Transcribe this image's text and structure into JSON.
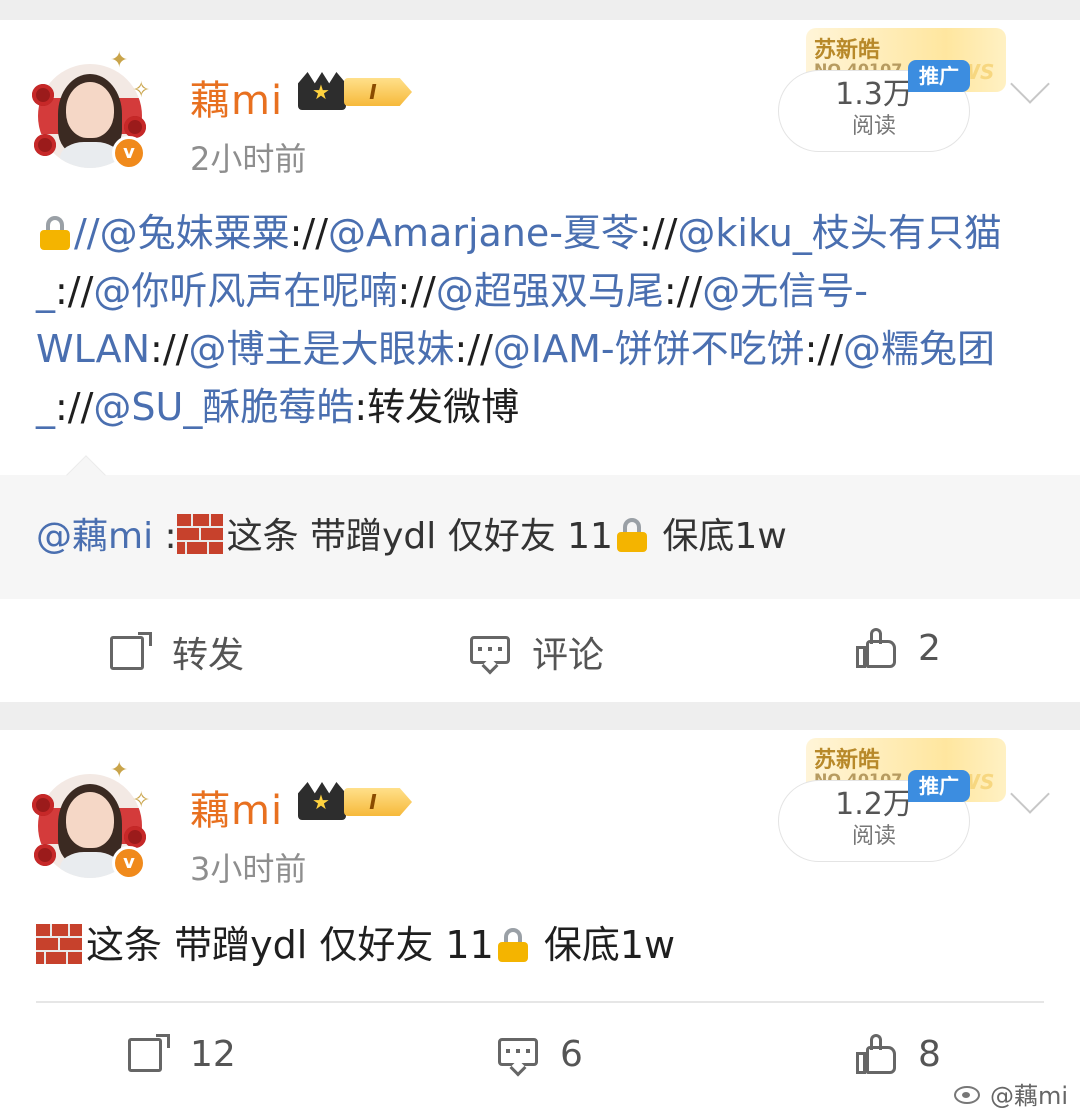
{
  "posts": [
    {
      "username": "藕mi",
      "level_label": "I",
      "time": "2小时前",
      "promo_name": "苏新皓",
      "promo_no": "NO.40107",
      "promo_ws": "WS",
      "promo_tag": "推广",
      "reads": "1.3万",
      "reads_label": "阅读",
      "body": {
        "seg1": "//@兔妹粟粟",
        "seg2": "://",
        "seg3": "@Amarjane-夏苓",
        "seg4": "://",
        "seg5": "@kiku_枝头有只猫_",
        "seg6": "://",
        "seg7": "@你听风声在呢喃",
        "seg8": "://",
        "seg9": "@超强双马尾",
        "seg10": "://",
        "seg11": "@无信号-WLAN",
        "seg12": "://",
        "seg13": "@博主是大眼妹",
        "seg14": "://",
        "seg15": "@IAM-饼饼不吃饼",
        "seg16": "://",
        "seg17": "@糯兔团_",
        "seg18": "://",
        "seg19": "@SU_酥脆莓皓",
        "seg20": ":转发微博"
      },
      "quote": {
        "mention": "@藕mi",
        "sep": " :",
        "text_a": "这条 带蹭ydl 仅好友 11",
        "text_b": " 保底1w"
      },
      "actions": {
        "repost": "转发",
        "comment": "评论",
        "like": "2"
      }
    },
    {
      "username": "藕mi",
      "level_label": "I",
      "time": "3小时前",
      "promo_name": "苏新皓",
      "promo_no": "NO.40107",
      "promo_ws": "WS",
      "promo_tag": "推广",
      "reads": "1.2万",
      "reads_label": "阅读",
      "body": {
        "text_a": "这条 带蹭ydl 仅好友 11",
        "text_b": " 保底1w"
      },
      "actions": {
        "repost": "12",
        "comment": "6",
        "like": "8"
      }
    }
  ],
  "watermark": "@藕mi",
  "colors": {
    "username": "#e8701f",
    "link": "#4a6fb0",
    "promo_tag": "#3c8de0",
    "verified": "#f08a1c"
  },
  "icons": [
    "lock-emoji",
    "brick-emoji",
    "repost-icon",
    "comment-icon",
    "like-icon",
    "crown-icon",
    "verified-v-icon",
    "chevron-down-icon",
    "weibo-logo-icon"
  ]
}
